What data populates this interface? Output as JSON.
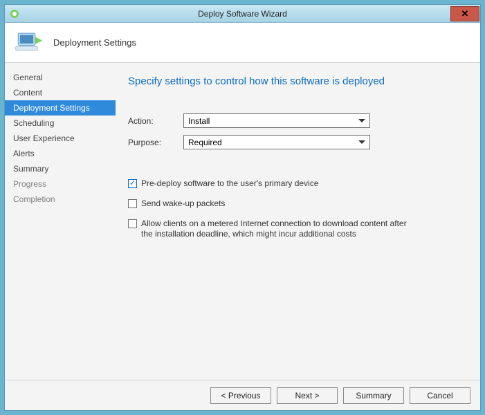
{
  "window": {
    "title": "Deploy Software Wizard"
  },
  "banner": {
    "title": "Deployment Settings"
  },
  "sidebar": {
    "items": [
      {
        "label": "General",
        "state": "normal"
      },
      {
        "label": "Content",
        "state": "normal"
      },
      {
        "label": "Deployment Settings",
        "state": "active"
      },
      {
        "label": "Scheduling",
        "state": "normal"
      },
      {
        "label": "User Experience",
        "state": "normal"
      },
      {
        "label": "Alerts",
        "state": "normal"
      },
      {
        "label": "Summary",
        "state": "normal"
      },
      {
        "label": "Progress",
        "state": "dim"
      },
      {
        "label": "Completion",
        "state": "dim"
      }
    ]
  },
  "heading": "Specify settings to control how this software is deployed",
  "form": {
    "action": {
      "label": "Action:",
      "value": "Install"
    },
    "purpose": {
      "label": "Purpose:",
      "value": "Required"
    }
  },
  "checks": {
    "predeploy": {
      "checked": true,
      "label": "Pre-deploy software to the user's primary device"
    },
    "wakeup": {
      "checked": false,
      "label": "Send wake-up packets"
    },
    "metered": {
      "checked": false,
      "label": "Allow clients on a metered Internet connection to download content after the installation deadline, which might incur additional costs"
    }
  },
  "buttons": {
    "previous": "< Previous",
    "next": "Next >",
    "summary": "Summary",
    "cancel": "Cancel"
  }
}
